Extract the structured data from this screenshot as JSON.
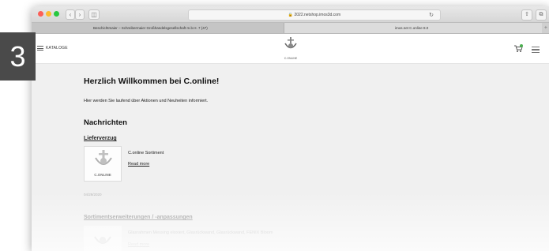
{
  "step": {
    "number": "3"
  },
  "browser": {
    "url": "2022.netshop.imos3d.com",
    "tabs": [
      {
        "label": "Beschichtmaier – Schreibermaier Großhandelsgesellschaft m.b.H. 7 (47)"
      },
      {
        "label": "imos.net C.online 8.0"
      }
    ],
    "icons": [
      "back-icon",
      "forward-icon",
      "sidebar-icon",
      "lock-icon",
      "reload-icon",
      "share-icon",
      "tabs-icon",
      "new-tab-icon"
    ]
  },
  "header": {
    "catalog_label": "KATALOGE",
    "logo_text": "C.ONLINE",
    "cart_badge_color": "#4caf50"
  },
  "main": {
    "welcome_title": "Herzlich Willkommen bei C.online!",
    "intro_text": "Hier werden Sie laufend über Aktionen und Neuheiten informiert.",
    "news_heading": "Nachrichten",
    "news": [
      {
        "title": "Lieferverzug",
        "thumb_label": "C.ONLINE",
        "text": "C.online Sortiment",
        "link": "Read more",
        "date": "04/29/2020"
      },
      {
        "title": "Sortimentserweiterungen / -anpassungen",
        "text": "Glasrahmen Messing eloxiert, Glasrückwand, Glasrückwand, FENIX Bloom",
        "link": "Read more"
      }
    ]
  }
}
